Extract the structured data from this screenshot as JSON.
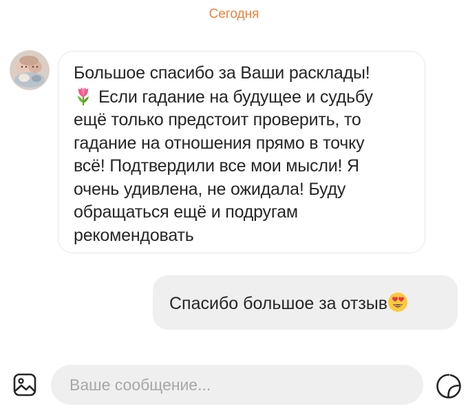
{
  "chat": {
    "date_separator": "Сегодня",
    "incoming": {
      "lines": [
        "Большое спасибо за Ваши расклады!",
        "Если гадание на будущее и судьбу",
        "ещё только предстоит проверить, то",
        "гадание на отношения прямо в точку",
        "всё! Подтвердили все мои мысли! Я",
        "очень удивлена, не ожидала! Буду",
        "обращаться ещё и подругам",
        "рекомендовать"
      ],
      "emoji_icon": "tulip-emoji"
    },
    "outgoing": {
      "text": "Спасибо большое за отзыв",
      "emoji_icon": "heart-eyes-emoji"
    }
  },
  "composer": {
    "placeholder": "Ваше сообщение...",
    "value": "",
    "left_icon": "image-icon",
    "right_icon": "sticker-icon"
  },
  "colors": {
    "accent": "#f0823c",
    "bubble_outgoing": "#efefef",
    "bubble_incoming_border": "#e7e7e7",
    "input_background": "#efefef",
    "text": "#262626",
    "placeholder": "#a7a7a7"
  }
}
